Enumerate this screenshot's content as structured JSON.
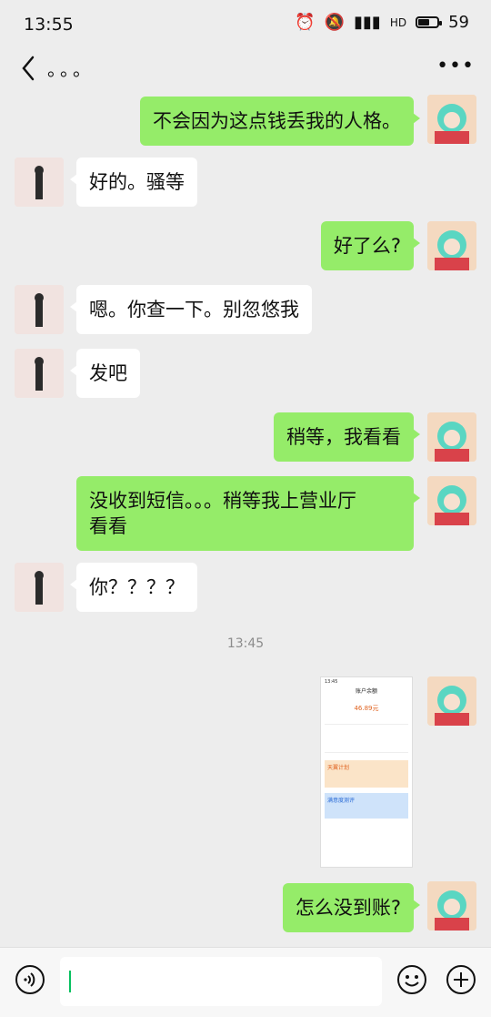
{
  "status": {
    "time": "13:55",
    "battery": "59",
    "battery_level": 0.59
  },
  "nav": {
    "title": "。。。"
  },
  "messages": [
    {
      "side": "right",
      "text": "不会因为这点钱丢我的人格。"
    },
    {
      "side": "left",
      "text": "好的。骚等"
    },
    {
      "side": "right",
      "text": "好了么?"
    },
    {
      "side": "left",
      "text": "嗯。你查一下。别忽悠我"
    },
    {
      "side": "left",
      "text": "发吧"
    },
    {
      "side": "right",
      "text": "稍等，我看看"
    },
    {
      "side": "right",
      "line1": "没收到短信。。。稍等我上营业厅",
      "line2": "看看"
    },
    {
      "side": "left",
      "text": "你？？？？"
    },
    {
      "side": "right",
      "text": "怎么没到账?"
    }
  ],
  "timestamp": "13:45",
  "screenshot_message": {
    "time": "13:45",
    "title": "账户余额",
    "amount": "46.89元",
    "banner1": "天翼计划",
    "banner2": "满意度测评"
  },
  "input": {
    "placeholder": ""
  }
}
